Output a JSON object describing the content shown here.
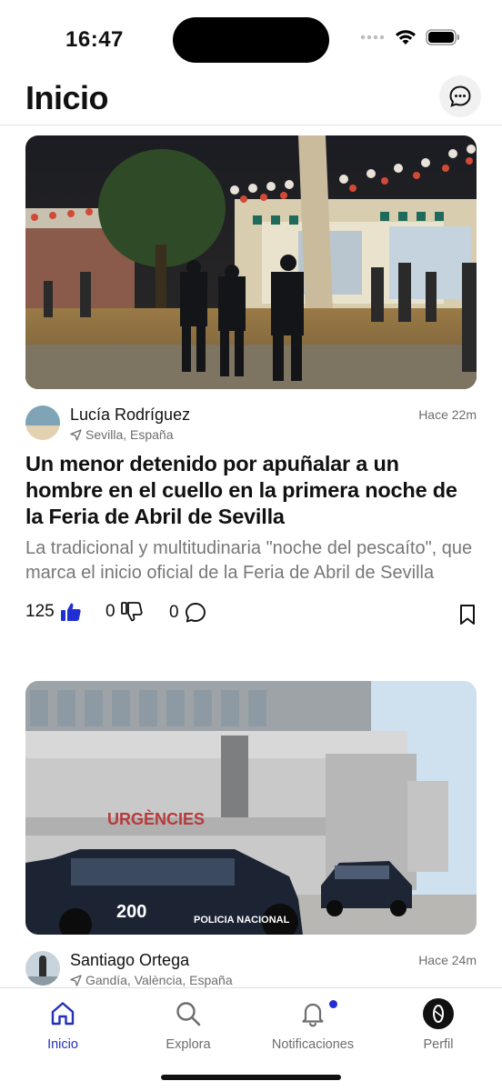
{
  "status_bar": {
    "time": "16:47"
  },
  "header": {
    "title": "Inicio"
  },
  "posts": [
    {
      "author": "Lucía Rodríguez",
      "location": "Sevilla, España",
      "time_ago": "Hace 22m",
      "headline": "Un menor detenido por apuñalar a un hombre en el cuello en la primera noche de la Feria de Abril de Sevilla",
      "summary": "La tradicional y multitudinaria \"noche del pescaíto\", que marca el inicio oficial de la Feria de Abril de Sevilla",
      "likes": "125",
      "dislikes": "0",
      "comments": "0"
    },
    {
      "author": "Santiago Ortega",
      "location": "Gandía, València, España",
      "time_ago": "Hace 24m",
      "image_sign": "URGÈNCIES",
      "car_text": "POLICIA NACIONAL",
      "car_badge": "200"
    }
  ],
  "tabs": [
    {
      "label": "Inicio",
      "icon": "home-icon",
      "active": true
    },
    {
      "label": "Explora",
      "icon": "search-icon",
      "active": false
    },
    {
      "label": "Notificaciones",
      "icon": "bell-icon",
      "active": false,
      "badge": true
    },
    {
      "label": "Perfil",
      "icon": "profile-avatar-icon",
      "active": false
    }
  ],
  "colors": {
    "accent": "#2330b8",
    "like": "#1f2fd1",
    "muted": "#6d6d6d"
  }
}
